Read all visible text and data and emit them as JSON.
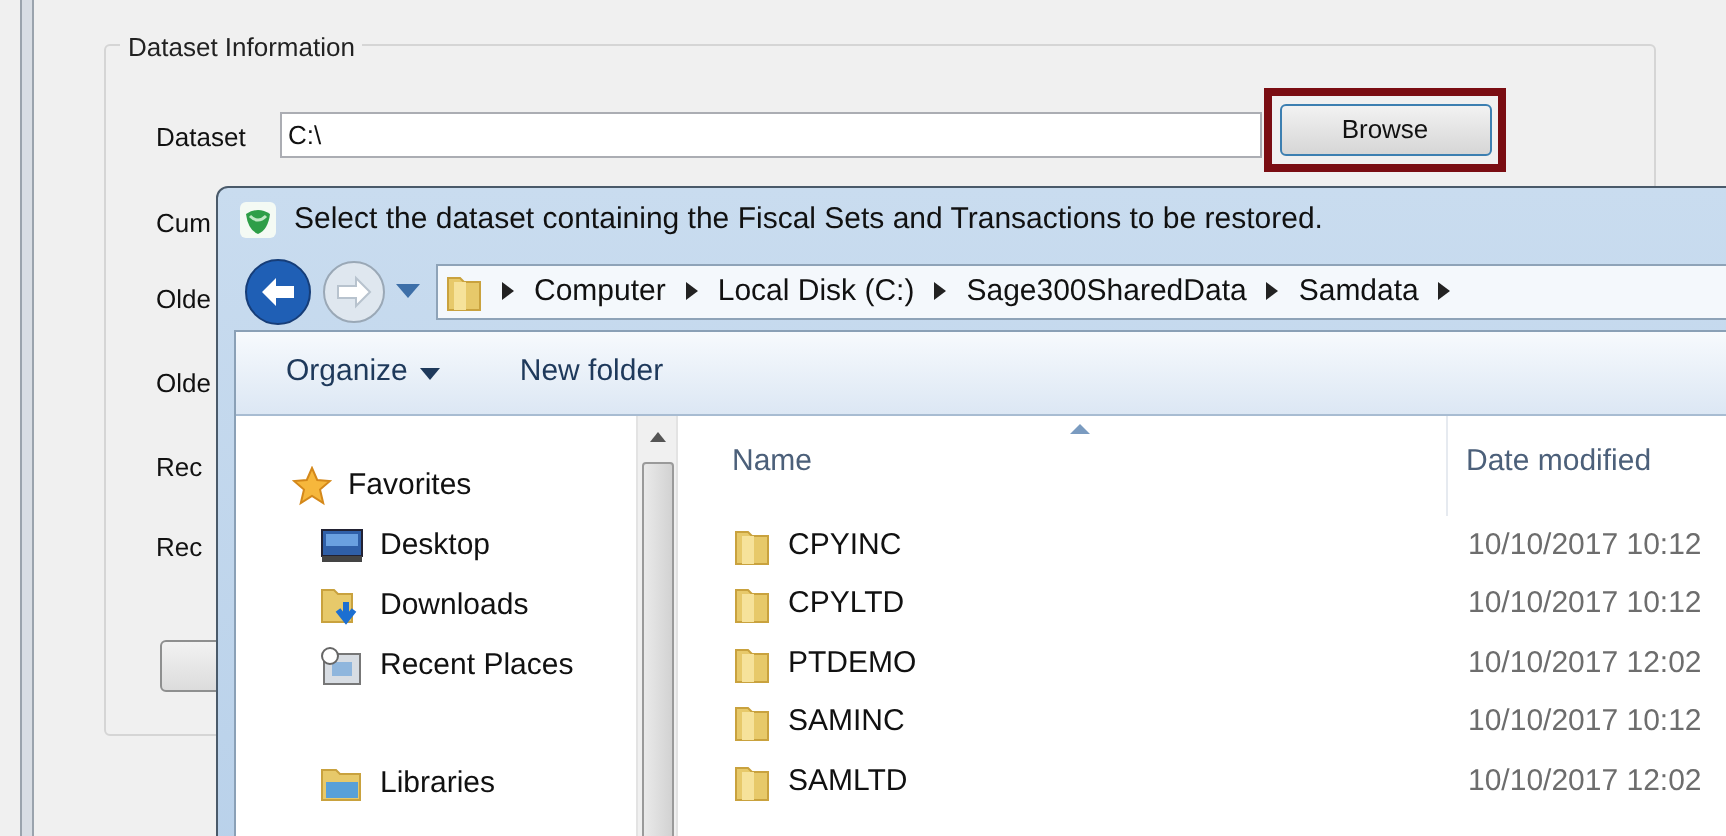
{
  "background_window": {
    "group_title": "Dataset Information",
    "dataset_label": "Dataset",
    "dataset_value": "C:\\",
    "browse_button": {
      "label": "Browse",
      "highlighted": true
    },
    "cut_labels": [
      "Cum",
      "Olde",
      "Olde",
      "Rec",
      "Rec"
    ]
  },
  "dialog": {
    "title": "Select the dataset containing the Fiscal Sets and Transactions to be restored.",
    "breadcrumb": [
      "Computer",
      "Local Disk (C:)",
      "Sage300SharedData",
      "Samdata"
    ],
    "toolbar": [
      {
        "label": "Organize",
        "dropdown": true
      },
      {
        "label": "New folder",
        "dropdown": false
      }
    ],
    "nav": [
      {
        "label": "Favorites",
        "kind": "group"
      },
      {
        "label": "Desktop",
        "kind": "desktop"
      },
      {
        "label": "Downloads",
        "kind": "downloads"
      },
      {
        "label": "Recent Places",
        "kind": "recent"
      },
      {
        "label": "Libraries",
        "kind": "libraries"
      }
    ],
    "columns": [
      "Name",
      "Date modified"
    ],
    "rows": [
      {
        "name": "CPYINC",
        "date": "10/10/2017 10:12"
      },
      {
        "name": "CPYLTD",
        "date": "10/10/2017 10:12"
      },
      {
        "name": "PTDEMO",
        "date": "10/10/2017 12:02"
      },
      {
        "name": "SAMINC",
        "date": "10/10/2017 10:12"
      },
      {
        "name": "SAMLTD",
        "date": "10/10/2017 12:02"
      }
    ]
  }
}
